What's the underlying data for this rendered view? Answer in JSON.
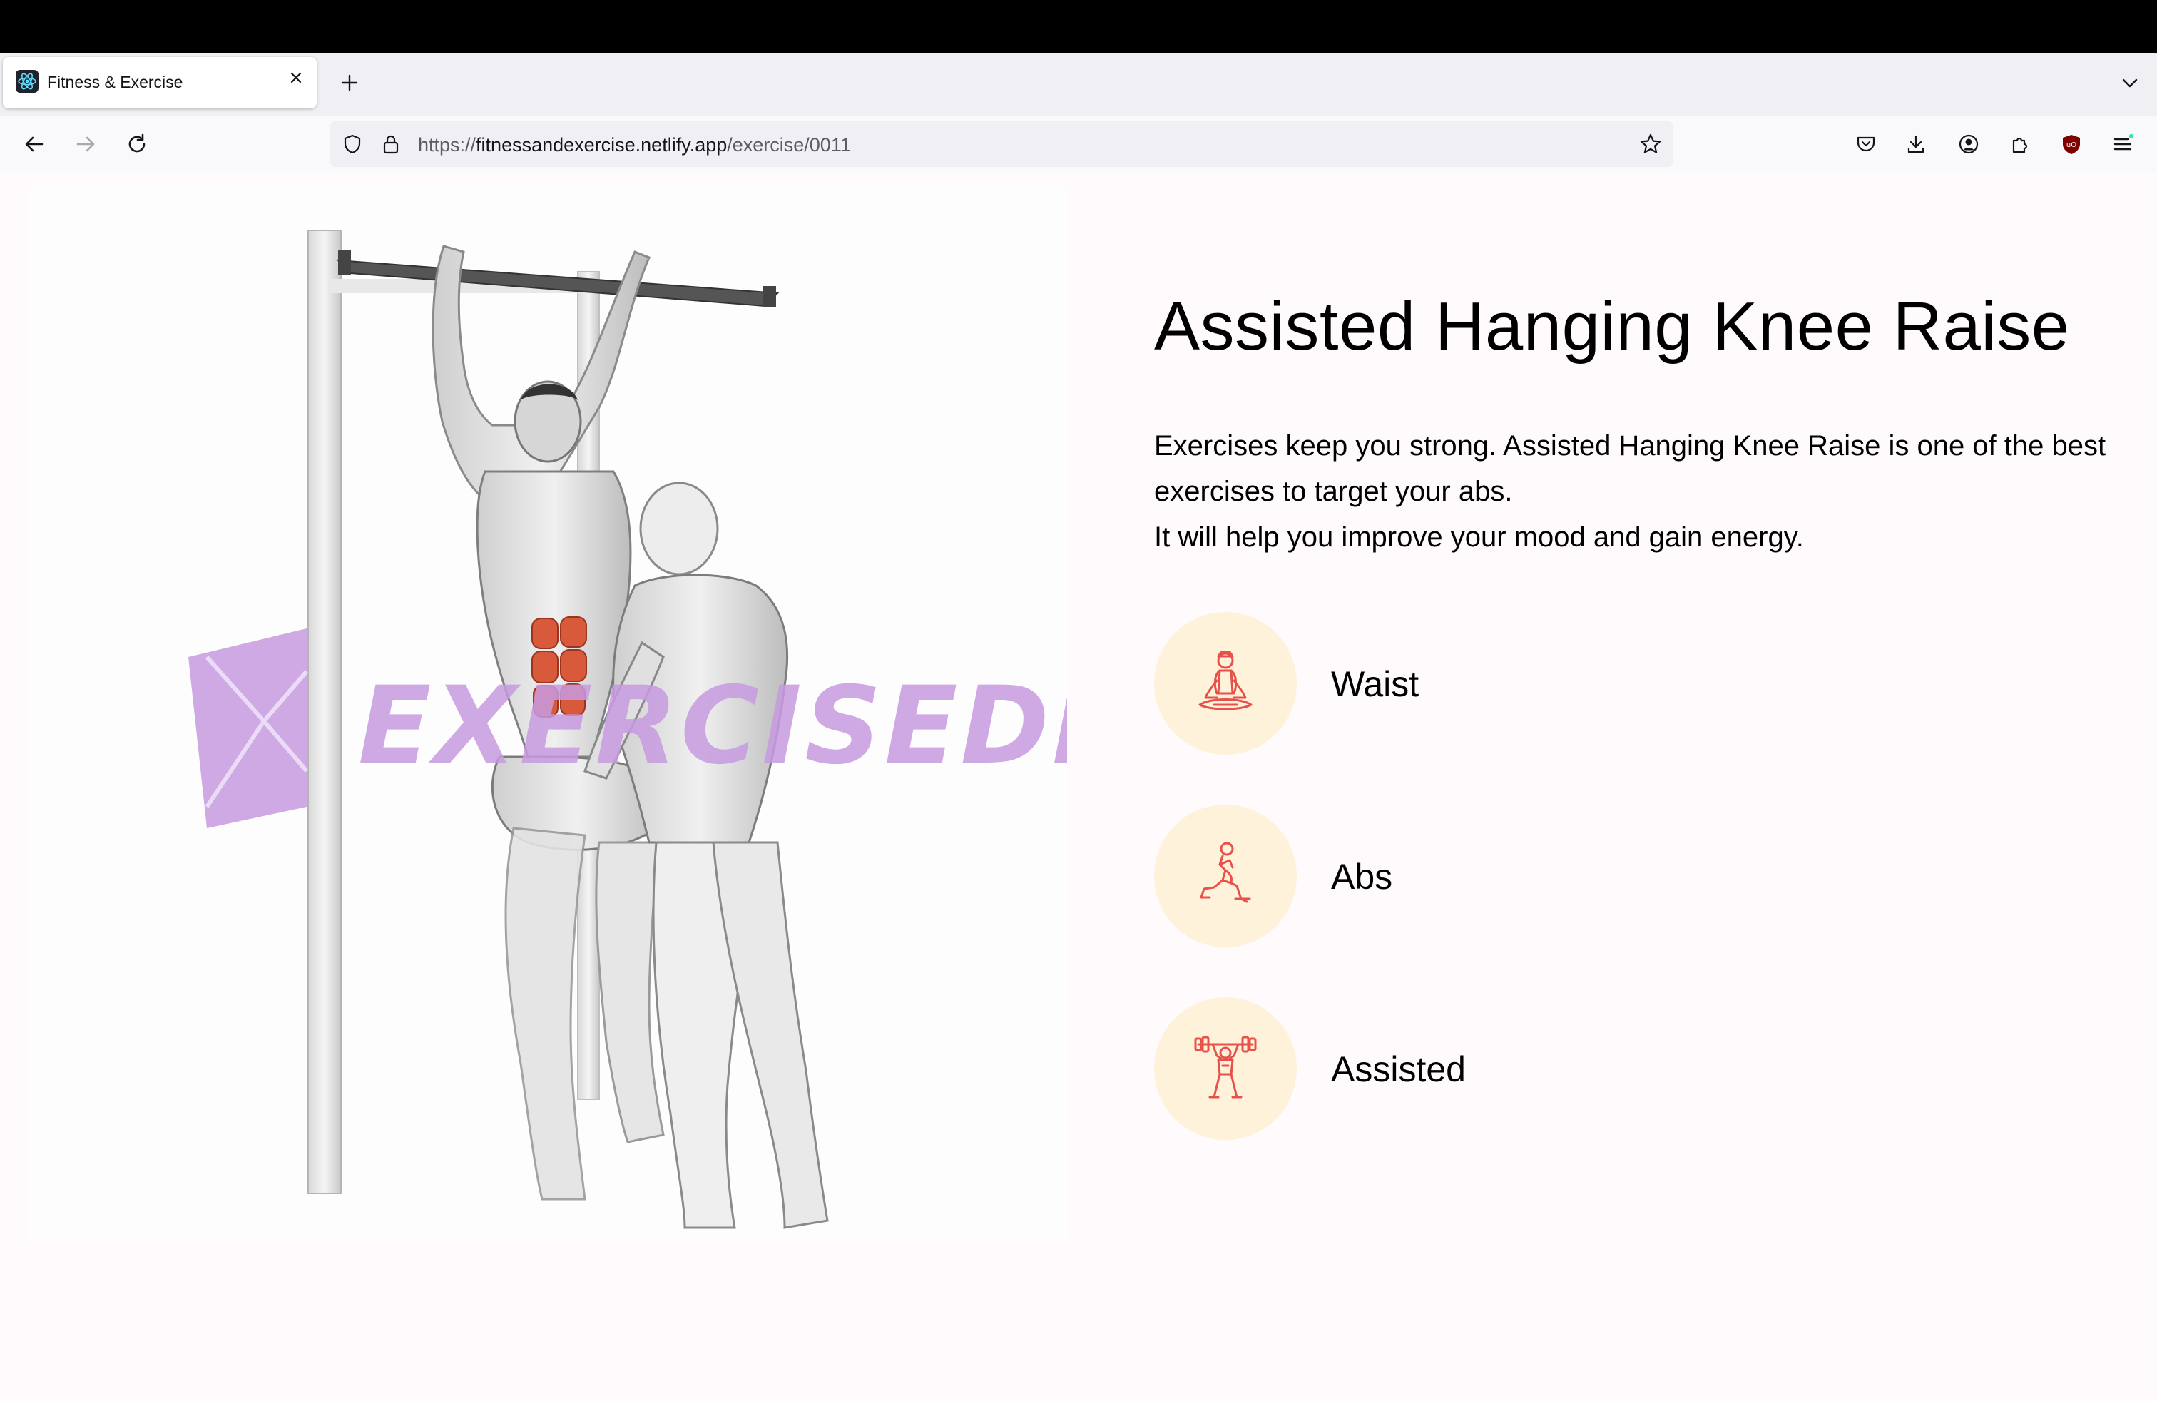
{
  "browser": {
    "tab": {
      "title": "Fitness & Exercise",
      "favicon": "react-logo-icon"
    },
    "address_bar": {
      "scheme": "https://",
      "host": "fitnessandexercise.netlify.app",
      "path": "/exercise/0011"
    },
    "toolbar_icons": [
      "pocket-icon",
      "download-icon",
      "account-icon",
      "extensions-icon",
      "ublock-icon",
      "menu-icon"
    ]
  },
  "exercise": {
    "title": "Assisted Hanging Knee Raise",
    "description_line1": "Exercises keep you strong. Assisted Hanging Knee Raise is one of the best exercises to target your abs.",
    "description_line2": "It will help you improve your mood and gain energy.",
    "image_watermark": "EXERCISEDB",
    "tags": [
      {
        "label": "Waist",
        "icon": "meditation-pose-icon"
      },
      {
        "label": "Abs",
        "icon": "lunge-stretch-icon"
      },
      {
        "label": "Assisted",
        "icon": "weightlifter-icon"
      }
    ]
  },
  "colors": {
    "tag_circle": "#fff2db",
    "tag_icon": "#e8504a",
    "watermark": "#c79be0",
    "muscle_highlight": "#d85a3a"
  }
}
